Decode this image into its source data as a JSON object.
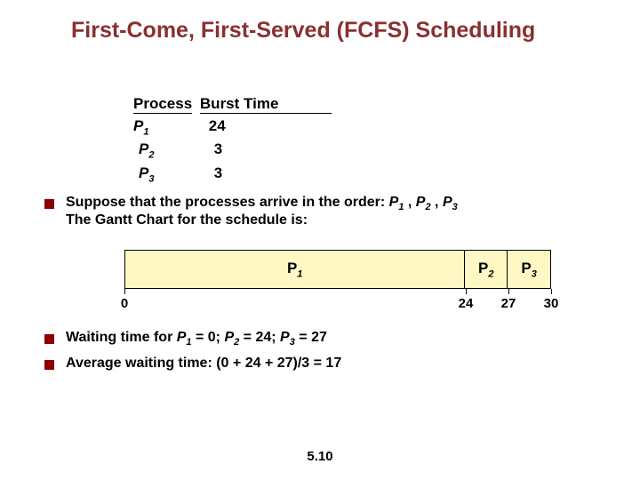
{
  "title": "First-Come, First-Served (FCFS) Scheduling",
  "table": {
    "header_process": "Process",
    "header_burst": "Burst Time",
    "rows": [
      {
        "name_prefix": "P",
        "name_sub": "1",
        "burst": "24"
      },
      {
        "name_prefix": "P",
        "name_sub": "2",
        "burst": "3"
      },
      {
        "name_prefix": "P",
        "name_sub": "3",
        "burst": "3"
      }
    ]
  },
  "bullets": {
    "b1_pre": "Suppose that the processes arrive in the order: ",
    "b1_p1p": "P",
    "b1_p1s": "1",
    "b1_sep1": " , ",
    "b1_p2p": "P",
    "b1_p2s": "2",
    "b1_sep2": " , ",
    "b1_p3p": "P",
    "b1_p3s": "3",
    "b1_line2": "The Gantt Chart for the schedule is:",
    "b2_pre": "Waiting time for ",
    "b2_p1p": "P",
    "b2_p1s": "1",
    "b2_v1": "  = 0; ",
    "b2_p2p": "P",
    "b2_p2s": "2",
    "b2_v2": "  = 24; ",
    "b2_p3p": "P",
    "b2_p3s": "3",
    "b2_v3": " = 27",
    "b3": "Average waiting time:  (0 + 24 + 27)/3 = 17"
  },
  "chart_data": {
    "type": "bar",
    "orientation": "gantt",
    "total": 30,
    "segments": [
      {
        "label_prefix": "P",
        "label_sub": "1",
        "start": 0,
        "end": 24
      },
      {
        "label_prefix": "P",
        "label_sub": "2",
        "start": 24,
        "end": 27
      },
      {
        "label_prefix": "P",
        "label_sub": "3",
        "start": 27,
        "end": 30
      }
    ],
    "ticks": [
      {
        "value": "0",
        "pos": 0
      },
      {
        "value": "24",
        "pos": 24
      },
      {
        "value": "27",
        "pos": 27
      },
      {
        "value": "30",
        "pos": 30
      }
    ]
  },
  "page_number": "5.10"
}
